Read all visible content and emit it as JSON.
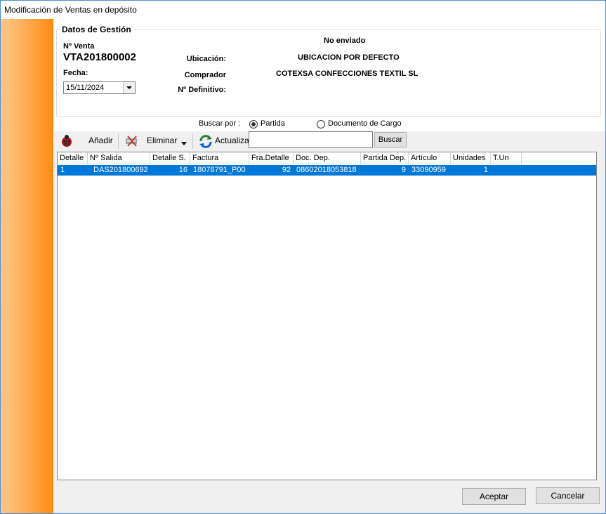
{
  "window": {
    "title": "Modificación de Ventas en depósito"
  },
  "gestion": {
    "legend": "Datos de Gestión",
    "venta_label": "Nº Venta",
    "venta_code": "VTA201800002",
    "fecha_label": "Fecha:",
    "fecha_value": "15/11/2024",
    "estado": "No enviado",
    "ubicacion_label": "Ubicación:",
    "ubicacion_value": "UBICACION POR DEFECTO",
    "comprador_label": "Comprador",
    "comprador_value": "COTEXSA CONFECCIONES TEXTIL SL",
    "definitivo_label": "Nº Definitivo:"
  },
  "search": {
    "label": "Buscar por :",
    "option_partida": "Partida",
    "option_documento": "Documento de Cargo",
    "selected": "Partida",
    "input_value": "",
    "button_label": "Buscar"
  },
  "toolbar": {
    "add_label": "Añadir",
    "delete_label": "Eliminar",
    "refresh_label": "Actualiza"
  },
  "grid": {
    "columns": [
      "Detalle",
      "Nº Salida",
      "Detalle S.",
      "Factura",
      "Fra.Detalle",
      "Doc. Dep.",
      "Partida Dep.",
      "Artículo",
      "Unidades",
      "T.Un"
    ],
    "rows": [
      {
        "detalle": "1",
        "salida": "DAS201800692",
        "detalle_s": "16",
        "factura": "18076791_P00",
        "fra_detalle": "92",
        "doc_dep": "08602018053818",
        "partida_dep": "9",
        "articulo": "33090959",
        "unidades": "1",
        "t_un": ""
      }
    ]
  },
  "footer": {
    "accept_label": "Aceptar",
    "cancel_label": "Cancelar"
  },
  "colors": {
    "selection": "#0078d7",
    "sidebar_start": "#ffc789",
    "sidebar_end": "#ff8b10"
  }
}
